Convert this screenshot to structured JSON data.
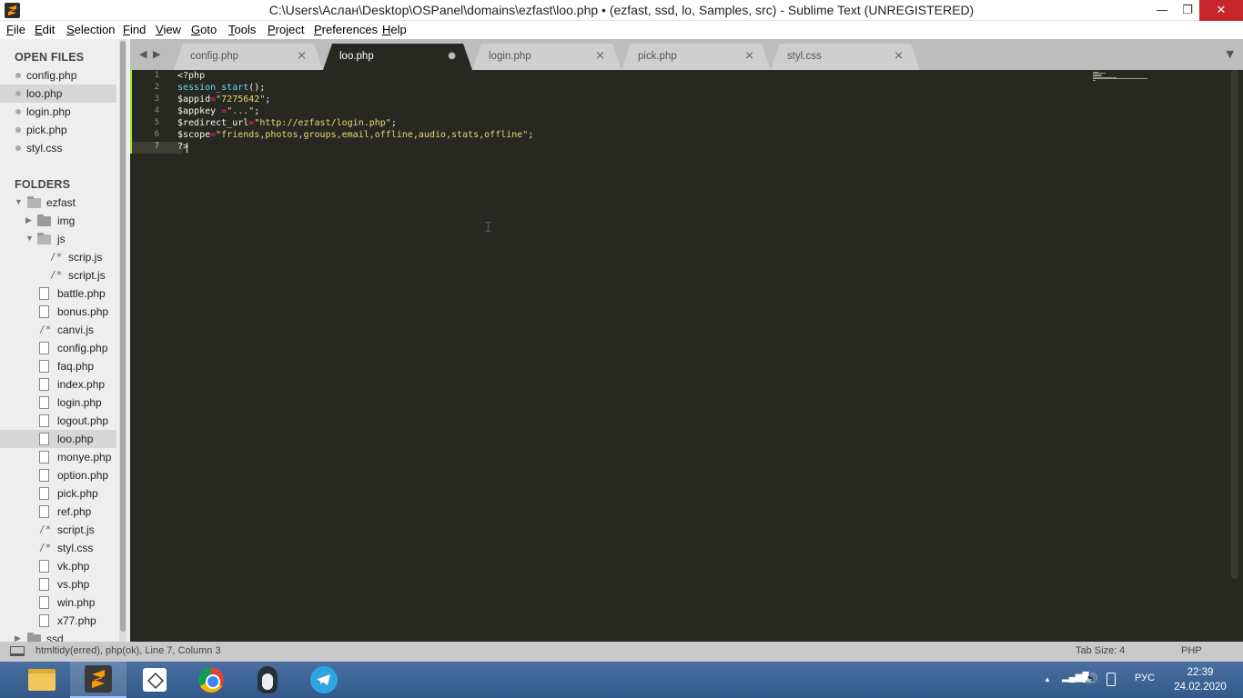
{
  "window": {
    "title": "C:\\Users\\Аслан\\Desktop\\OSPanel\\domains\\ezfast\\loo.php • (ezfast, ssd, lo, Samples, src) - Sublime Text (UNREGISTERED)",
    "min_glyph": "—",
    "max_glyph": "❐",
    "close_glyph": "✕"
  },
  "menu": [
    "File",
    "Edit",
    "Selection",
    "Find",
    "View",
    "Goto",
    "Tools",
    "Project",
    "Preferences",
    "Help"
  ],
  "sidebar": {
    "open_files_heading": "OPEN FILES",
    "open_files": [
      "config.php",
      "loo.php",
      "login.php",
      "pick.php",
      "styl.css"
    ],
    "folders_heading": "FOLDERS",
    "root_folder": "ezfast",
    "img_folder": "img",
    "js_folder": "js",
    "js_files": [
      "scrip.js",
      "script.js"
    ],
    "files": [
      "battle.php",
      "bonus.php",
      "canvi.js",
      "config.php",
      "faq.php",
      "index.php",
      "login.php",
      "logout.php",
      "loo.php",
      "monye.php",
      "option.php",
      "pick.php",
      "ref.php",
      "script.js",
      "styl.css",
      "vk.php",
      "vs.php",
      "win.php",
      "x77.php"
    ],
    "next_folder": "ssd",
    "js_glyph": "/*"
  },
  "tabs": {
    "items": [
      "config.php",
      "loo.php",
      "login.php",
      "pick.php",
      "styl.css"
    ],
    "active_index": 1,
    "close_glyph": "×",
    "dirty_glyph": "●",
    "nav_left": "◀",
    "nav_right": "▶",
    "dropdown": "▼"
  },
  "editor": {
    "line_numbers": [
      "1",
      "2",
      "3",
      "4",
      "5",
      "6",
      "7"
    ],
    "current_line": 7,
    "lines": [
      [
        {
          "t": "<?php",
          "c": "var"
        }
      ],
      [
        {
          "t": "session_start",
          "c": "fn"
        },
        {
          "t": "();",
          "c": "var"
        }
      ],
      [
        {
          "t": "$appid",
          "c": "var"
        },
        {
          "t": "=",
          "c": "op"
        },
        {
          "t": "\"7275642\"",
          "c": "str"
        },
        {
          "t": ";",
          "c": "var"
        }
      ],
      [
        {
          "t": "$appkey ",
          "c": "var"
        },
        {
          "t": "=",
          "c": "op"
        },
        {
          "t": "\"...\"",
          "c": "str"
        },
        {
          "t": ";",
          "c": "var"
        }
      ],
      [
        {
          "t": "$redirect_url",
          "c": "var"
        },
        {
          "t": "=",
          "c": "op"
        },
        {
          "t": "\"http://ezfast/login.php\"",
          "c": "str"
        },
        {
          "t": ";",
          "c": "var"
        }
      ],
      [
        {
          "t": "$scope",
          "c": "var"
        },
        {
          "t": "=",
          "c": "op"
        },
        {
          "t": "\"friends,photos,groups,email,offline,audio,stats,offline\"",
          "c": "str"
        },
        {
          "t": ";",
          "c": "var"
        }
      ],
      [
        {
          "t": "?>",
          "c": "var"
        }
      ]
    ],
    "ibeam_glyph": "I"
  },
  "status": {
    "left": "htmltidy(erred), php(ok), Line 7, Column 3",
    "tab_size": "Tab Size: 4",
    "syntax": "PHP"
  },
  "taskbar": {
    "apps": [
      "file-explorer",
      "sublime-text",
      "3d-box-app",
      "chrome",
      "penguin-app",
      "telegram"
    ],
    "tray_up": "▲",
    "signal": "▂▄▆█",
    "volume": "🔊",
    "lang": "РУС",
    "time": "22:39",
    "date": "24.02.2020"
  }
}
